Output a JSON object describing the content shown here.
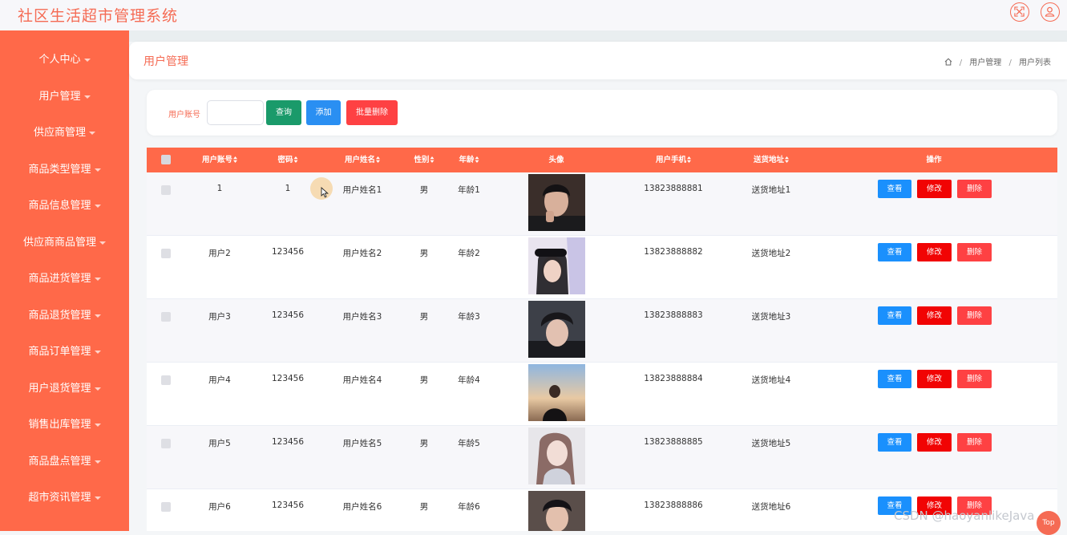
{
  "app": {
    "title": "社区生活超市管理系统"
  },
  "icons": {
    "fullscreen": "fullscreen-icon",
    "user": "user-icon",
    "home": "home-icon",
    "sort": "sort-icon",
    "cursor": "mouse-cursor-icon"
  },
  "colors": {
    "accent": "#ff6949",
    "title": "#f56b54",
    "query": "#1a9a6a",
    "add": "#2a8ff2",
    "batch": "#fe4143",
    "view": "#1a90fd",
    "edit": "#f10404",
    "delete": "#fe4143"
  },
  "sidebar": {
    "items": [
      {
        "label": "个人中心"
      },
      {
        "label": "用户管理"
      },
      {
        "label": "供应商管理"
      },
      {
        "label": "商品类型管理"
      },
      {
        "label": "商品信息管理"
      },
      {
        "label": "供应商商品管理"
      },
      {
        "label": "商品进货管理"
      },
      {
        "label": "商品退货管理"
      },
      {
        "label": "商品订单管理"
      },
      {
        "label": "用户退货管理"
      },
      {
        "label": "销售出库管理"
      },
      {
        "label": "商品盘点管理"
      },
      {
        "label": "超市资讯管理"
      }
    ]
  },
  "header": {
    "page_title": "用户管理",
    "breadcrumb": [
      "用户管理",
      "用户列表"
    ]
  },
  "search": {
    "label": "用户账号",
    "value": "",
    "placeholder": "",
    "query_label": "查询",
    "add_label": "添加",
    "batch_delete_label": "批量删除"
  },
  "table": {
    "columns": [
      "用户账号",
      "密码",
      "用户姓名",
      "性别",
      "年龄",
      "头像",
      "用户手机",
      "送货地址",
      "操作"
    ],
    "actions": {
      "view": "查看",
      "edit": "修改",
      "delete": "删除"
    },
    "rows": [
      {
        "account": "1",
        "password": "1",
        "name": "用户姓名1",
        "gender": "男",
        "age": "年龄1",
        "phone": "13823888881",
        "address": "送货地址1"
      },
      {
        "account": "用户2",
        "password": "123456",
        "name": "用户姓名2",
        "gender": "男",
        "age": "年龄2",
        "phone": "13823888882",
        "address": "送货地址2"
      },
      {
        "account": "用户3",
        "password": "123456",
        "name": "用户姓名3",
        "gender": "男",
        "age": "年龄3",
        "phone": "13823888883",
        "address": "送货地址3"
      },
      {
        "account": "用户4",
        "password": "123456",
        "name": "用户姓名4",
        "gender": "男",
        "age": "年龄4",
        "phone": "13823888884",
        "address": "送货地址4"
      },
      {
        "account": "用户5",
        "password": "123456",
        "name": "用户姓名5",
        "gender": "男",
        "age": "年龄5",
        "phone": "13823888885",
        "address": "送货地址5"
      },
      {
        "account": "用户6",
        "password": "123456",
        "name": "用户姓名6",
        "gender": "男",
        "age": "年龄6",
        "phone": "13823888886",
        "address": "送货地址6"
      }
    ]
  },
  "watermark": "CSDN @haoyanlikeJava",
  "back_to_top": "Top"
}
